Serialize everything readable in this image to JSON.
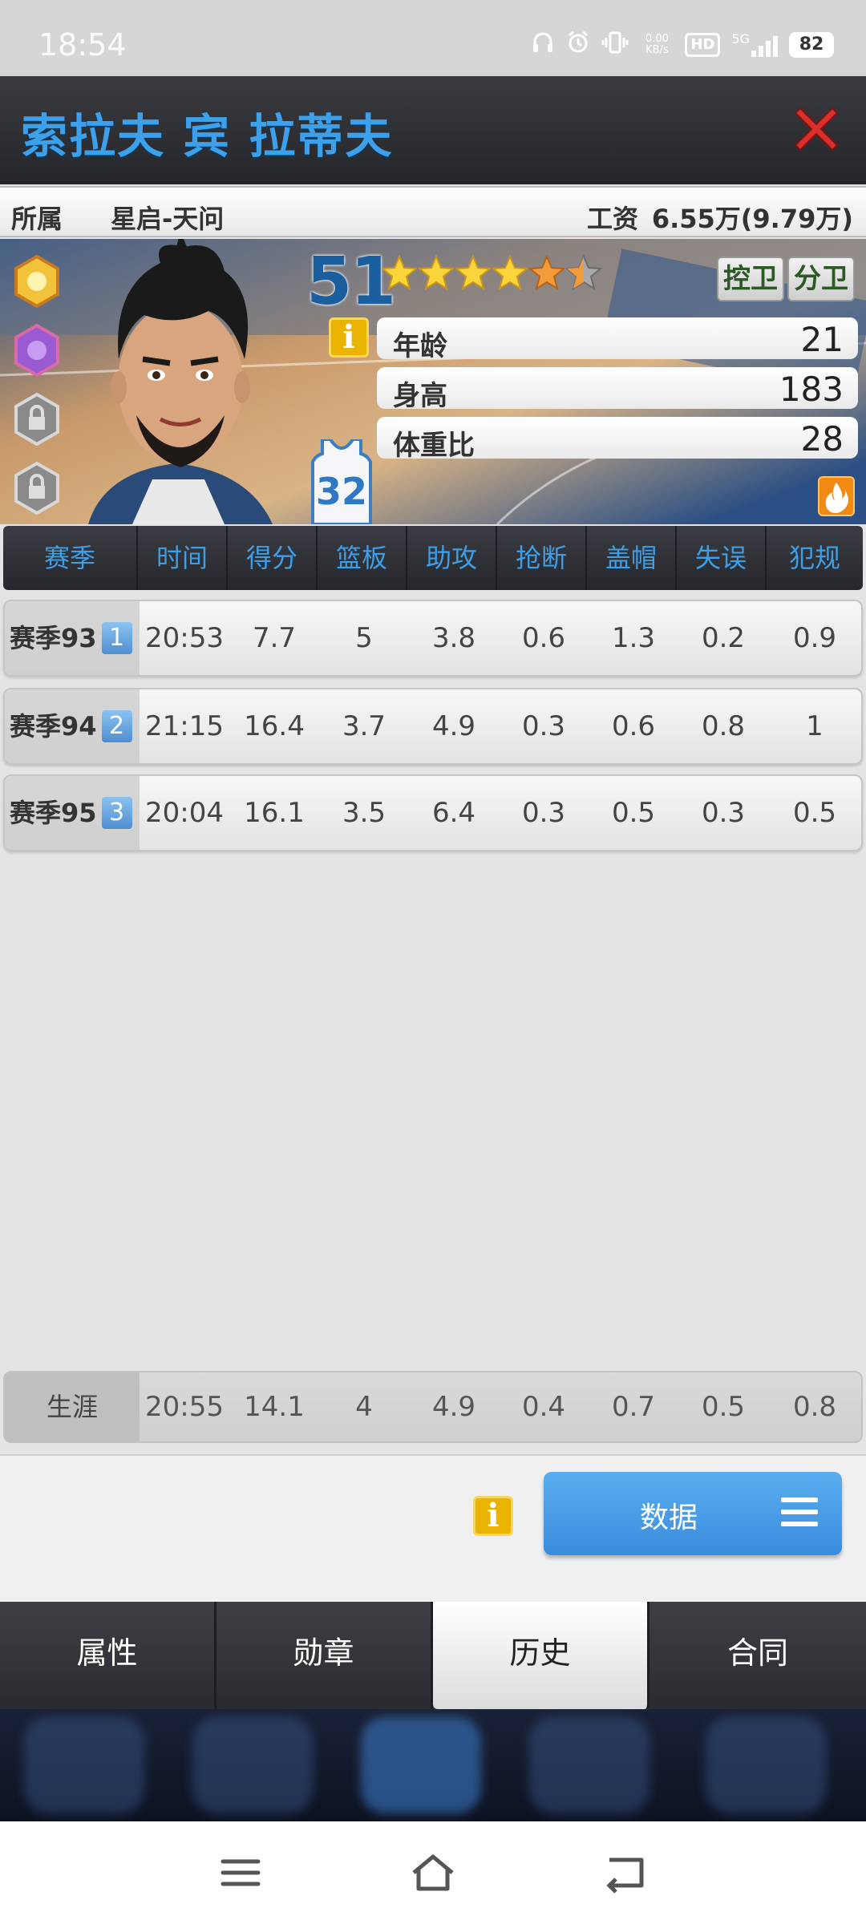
{
  "status_bar": {
    "time": "18:54",
    "net_speed": "0.00 KB/s",
    "hd": "HD",
    "network": "5G",
    "battery": "82"
  },
  "header": {
    "title": "索拉夫 宾 拉蒂夫"
  },
  "info": {
    "team_label": "所属",
    "team_value": "星启-天问",
    "salary_label": "工资",
    "salary_value": "6.55万(9.79万)"
  },
  "player": {
    "rating": "51",
    "stars": 5.5,
    "positions": [
      "控卫",
      "分卫"
    ],
    "jersey": "32",
    "attributes": [
      {
        "label": "年龄",
        "value": "21"
      },
      {
        "label": "身高",
        "value": "183"
      },
      {
        "label": "体重比",
        "value": "28"
      }
    ]
  },
  "stats": {
    "columns": [
      "赛季",
      "时间",
      "得分",
      "篮板",
      "助攻",
      "抢断",
      "盖帽",
      "失误",
      "犯规"
    ],
    "rows": [
      {
        "season": "赛季93",
        "rank": "1",
        "values": [
          "20:53",
          "7.7",
          "5",
          "3.8",
          "0.6",
          "1.3",
          "0.2",
          "0.9"
        ]
      },
      {
        "season": "赛季94",
        "rank": "2",
        "values": [
          "21:15",
          "16.4",
          "3.7",
          "4.9",
          "0.3",
          "0.6",
          "0.8",
          "1"
        ]
      },
      {
        "season": "赛季95",
        "rank": "3",
        "values": [
          "20:04",
          "16.1",
          "3.5",
          "6.4",
          "0.3",
          "0.5",
          "0.3",
          "0.5"
        ]
      }
    ],
    "career": {
      "label": "生涯",
      "values": [
        "20:55",
        "14.1",
        "4",
        "4.9",
        "0.4",
        "0.7",
        "0.5",
        "0.8"
      ]
    }
  },
  "actions": {
    "info_icon": "i",
    "data_button": "数据"
  },
  "tabs": [
    {
      "label": "属性",
      "active": false
    },
    {
      "label": "勋章",
      "active": false
    },
    {
      "label": "历史",
      "active": true
    },
    {
      "label": "合同",
      "active": false
    }
  ],
  "colors": {
    "title_blue": "#3da0ea",
    "header_dark": "#2a2b30",
    "button_blue": "#4a9de6",
    "close_red": "#d9302b"
  }
}
